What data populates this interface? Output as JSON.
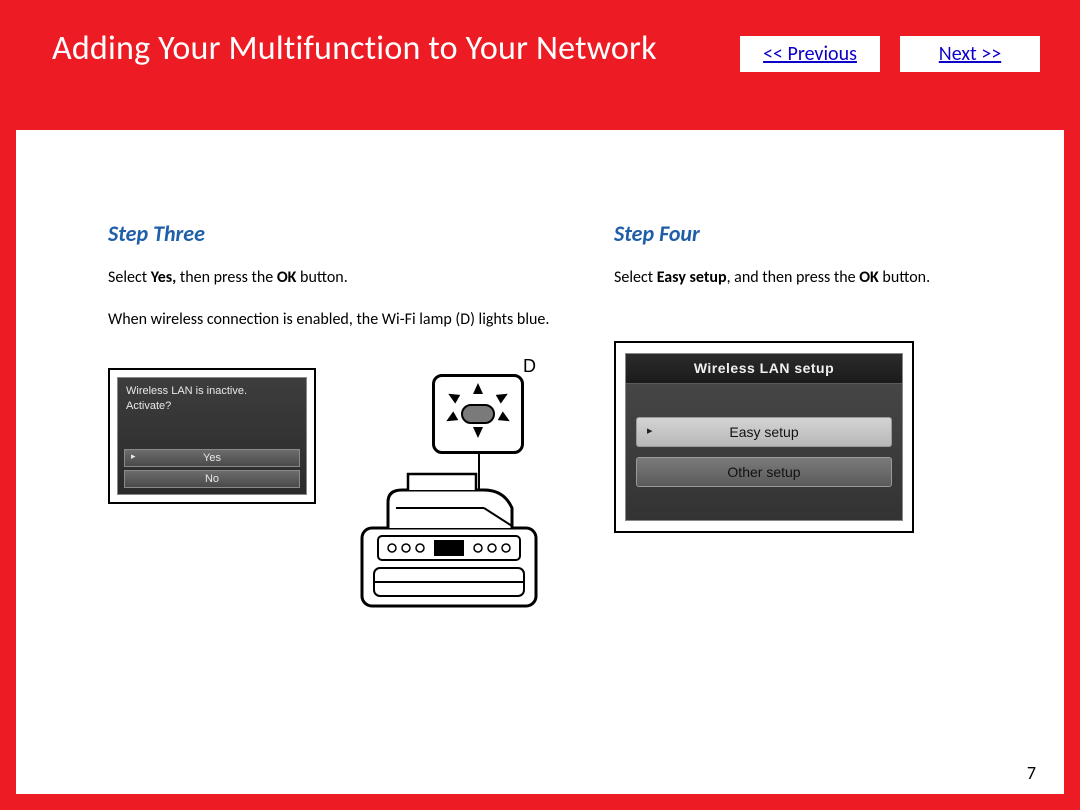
{
  "header": {
    "title": "Adding Your Multifunction to Your Network",
    "prev": "<< Previous",
    "next": "Next >>"
  },
  "left": {
    "step": "Step Three",
    "p1_pre": "Select ",
    "p1_b": "Yes,",
    "p1_post": " then press the ",
    "p1_b2": "OK",
    "p1_end": " button.",
    "p2": "When wireless connection is enabled, the Wi-Fi lamp (D) lights blue.",
    "lcd_msg1": "Wireless LAN is inactive.",
    "lcd_msg2": "Activate?",
    "lcd_yes": "Yes",
    "lcd_no": "No",
    "callout": "D"
  },
  "right": {
    "step": "Step Four",
    "p1_pre": "Select ",
    "p1_b": "Easy setup",
    "p1_mid": ", and then press the ",
    "p1_b2": "OK",
    "p1_end": " button.",
    "lcd_title": "Wireless LAN setup",
    "opt1": "Easy setup",
    "opt2": "Other setup"
  },
  "page_number": "7"
}
